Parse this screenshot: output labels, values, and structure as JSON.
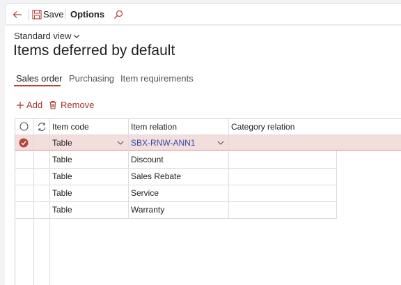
{
  "toolbar": {
    "save_label": "Save",
    "options_label": "Options"
  },
  "page": {
    "view_label": "Standard view",
    "title": "Items deferred by default"
  },
  "tabs": [
    {
      "label": "Sales order",
      "active": true
    },
    {
      "label": "Purchasing",
      "active": false
    },
    {
      "label": "Item requirements",
      "active": false
    }
  ],
  "actions": {
    "add_label": "Add",
    "remove_label": "Remove"
  },
  "grid": {
    "columns": [
      "Item code",
      "Item relation",
      "Category relation"
    ],
    "rows": [
      {
        "item_code": "Table",
        "item_relation": "SBX-RNW-ANN1",
        "category_relation": "",
        "selected": true
      },
      {
        "item_code": "Table",
        "item_relation": "Discount",
        "category_relation": "",
        "selected": false
      },
      {
        "item_code": "Table",
        "item_relation": "Sales Rebate",
        "category_relation": "",
        "selected": false
      },
      {
        "item_code": "Table",
        "item_relation": "Service",
        "category_relation": "",
        "selected": false
      },
      {
        "item_code": "Table",
        "item_relation": "Warranty",
        "category_relation": "",
        "selected": false
      }
    ]
  },
  "colors": {
    "accent": "#b5463c",
    "selected_row": "#f3dddd",
    "link": "#2f4ea3"
  }
}
